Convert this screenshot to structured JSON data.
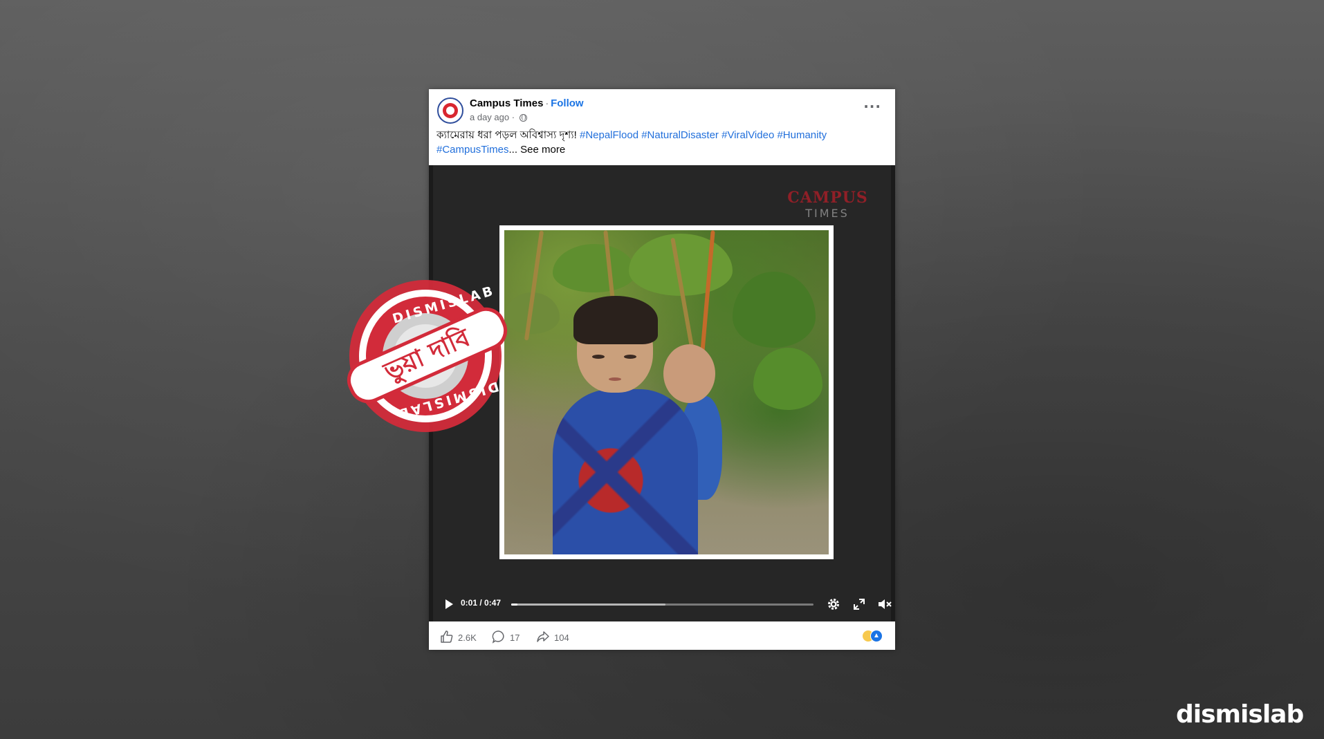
{
  "post": {
    "page_name": "Campus Times",
    "separator": "·",
    "follow_label": "Follow",
    "timestamp": "a day ago ·",
    "privacy_icon": "globe-icon",
    "more_icon": "more-options-icon",
    "caption_text": "ক্যামেরায় ধরা পড়ল অবিশ্বাস্য দৃশ্য! ",
    "hashtags_line1": [
      "#NepalFlood",
      "#NaturalDisaster",
      "#ViralVideo",
      "#Humanity"
    ],
    "hashtags_line2": [
      "#CampusTimes"
    ],
    "ellipsis": "...",
    "see_more_label": "See more"
  },
  "video": {
    "watermark": "CAMPUS",
    "watermark_sub": "TIMES",
    "time_display": "0:01 / 0:47",
    "progress_played": 0.02,
    "progress_buffered": 0.51,
    "controls": [
      "play-icon",
      "gear-icon",
      "expand-icon",
      "mute-icon"
    ]
  },
  "footer": {
    "likes": "2.6K",
    "comments": "17",
    "shares": "104",
    "reactions": [
      "sad-reaction-icon",
      "like-reaction-icon"
    ]
  },
  "stamp": {
    "top_text": "DISMISLAB",
    "bottom_text": "DISMISLAB",
    "banner_text": "ভুয়া দাবি"
  },
  "brand": {
    "logo_text": "dismislab"
  },
  "colors": {
    "hashtag": "#216fdb",
    "follow": "#1b74e4",
    "stamp_red": "#d22b3a",
    "video_bg": "#262626"
  }
}
